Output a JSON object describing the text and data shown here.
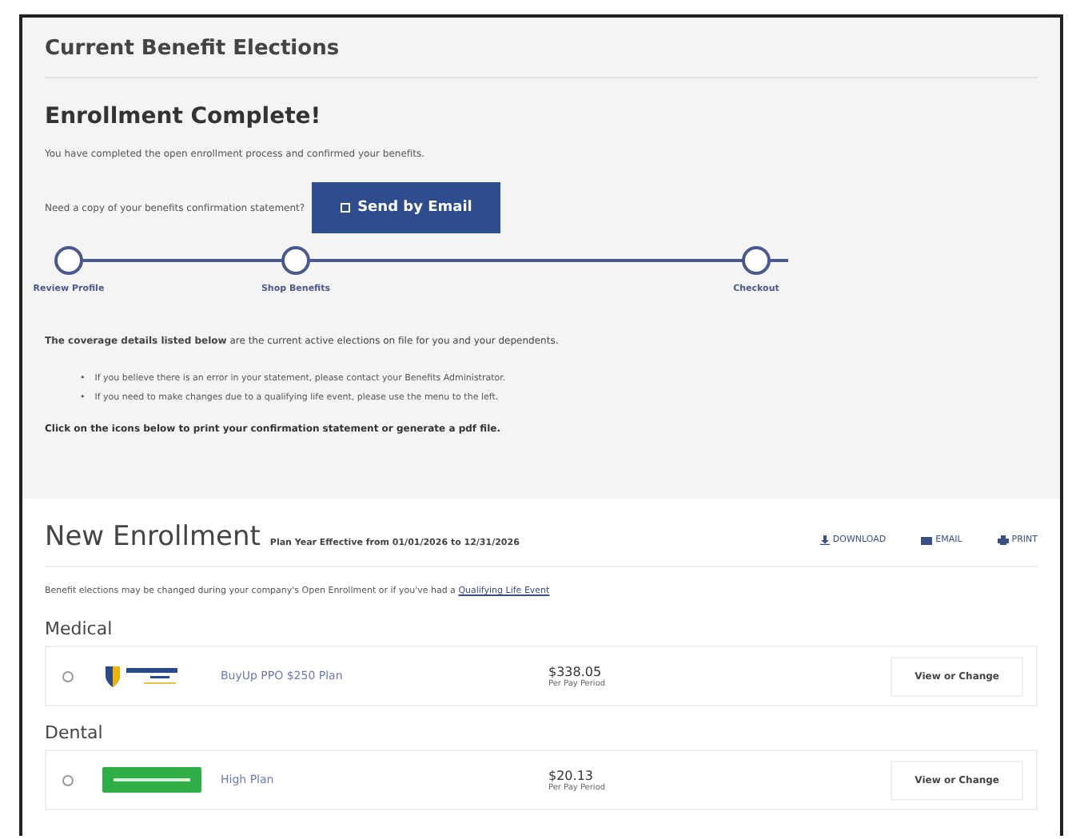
{
  "header": {
    "title": "Current Benefit Elections"
  },
  "confirmation": {
    "heading": "Enrollment Complete!",
    "message": "You have completed the open enrollment process and confirmed your benefits.",
    "copy_prompt": "Need a copy of your benefits confirmation statement?",
    "email_button": "Send by Email",
    "steps": [
      {
        "label": "Review Profile"
      },
      {
        "label": "Shop Benefits"
      },
      {
        "label": "Checkout"
      }
    ],
    "coverage_note": "**The coverage details listed below** are the current active elections on file for you and your dependents.",
    "bullet_marker": "•",
    "bullets": [
      "If you believe there is an error in your statement, please contact your Benefits Administrator.",
      "If you need to make changes due to a qualifying life event, please use the menu to the left."
    ],
    "print_note": "Click on the icons below to print your confirmation statement or generate a pdf file."
  },
  "enrollment": {
    "title": "New Enrollment",
    "subtitle": "Plan Year Effective from 01/01/2026 to 12/31/2026",
    "actions": [
      {
        "kind": "download",
        "label": "DOWNLOAD"
      },
      {
        "kind": "email",
        "label": "EMAIL"
      },
      {
        "kind": "print",
        "label": "PRINT"
      }
    ],
    "note": "Benefit elections may be changed during your company's Open Enrollment or if you've had a",
    "note_link": "Qualifying Life Event",
    "sections": [
      {
        "heading": "Medical",
        "plan": {
          "kind": "shield",
          "name": "BuyUp PPO $250 Plan",
          "price": "$338.05",
          "period": "Per Pay Period",
          "button": "View or Change"
        }
      },
      {
        "heading": "Dental",
        "plan": {
          "kind": "badge",
          "name": "High Plan",
          "price": "$20.13",
          "period": "Per Pay Period",
          "button": "View or Change"
        }
      }
    ]
  }
}
